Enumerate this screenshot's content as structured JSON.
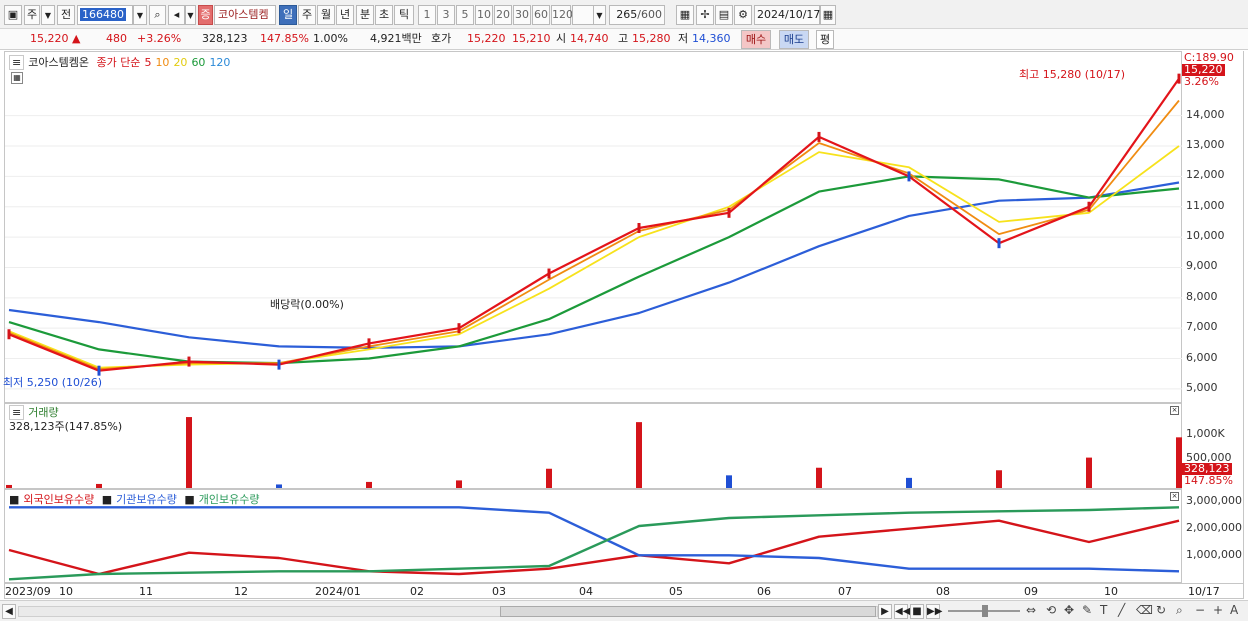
{
  "toolbar": {
    "market_label": "주",
    "all_label": "전",
    "code_value": "166480",
    "search_label": "Q",
    "sound_label": "◀",
    "badge_label": "증",
    "stock_name": "코아스템켐",
    "periods": [
      "일",
      "주",
      "월",
      "년",
      "분",
      "초",
      "틱"
    ],
    "active_period": "일",
    "intervals": [
      "1",
      "3",
      "5",
      "10",
      "20",
      "30",
      "60",
      "120"
    ],
    "count_value": "265",
    "count_total": "/600",
    "date_value": "2024/10/17"
  },
  "quote": {
    "price": "15,220",
    "change": "480",
    "change_pct": "+3.26%",
    "volume": "328,123",
    "volume_pct": "147.85%",
    "turnover_pct": "1.00%",
    "amount": "4,921백만",
    "ask_label": "호가",
    "ask": "15,220",
    "bid": "15,210",
    "open_label": "시",
    "open": "14,740",
    "high_label": "고",
    "high": "15,280",
    "low_label": "저",
    "low": "14,360",
    "buy_label": "매수",
    "sell_label": "매도",
    "eq_label": "평"
  },
  "price_panel": {
    "name": "코아스템켐온",
    "ma_title": "종가 단순",
    "ma_periods": [
      "5",
      "10",
      "20",
      "60",
      "120"
    ],
    "annotation_high": "최고 15,280 (10/17)",
    "annotation_low": "최저 5,250 (10/26)",
    "annotation_dividend": "배당락(0.00%)"
  },
  "price_axis": {
    "top_tag": "C:189.90",
    "price_tag": "15,220",
    "pct_tag": "3.26%",
    "ticks": [
      "14,000",
      "13,000",
      "12,000",
      "11,000",
      "10,000",
      "9,000",
      "8,000",
      "7,000",
      "6,000",
      "5,000"
    ]
  },
  "volume_panel": {
    "name": "거래량",
    "value": "328,123주(147.85%)"
  },
  "volume_axis": {
    "ticks": [
      "1,000K",
      "500,000"
    ],
    "tag_value": "328,123",
    "tag_pct": "147.85%"
  },
  "holdings_panel": {
    "series": [
      "외국인보유수량",
      "기관보유수량",
      "개인보유수량"
    ]
  },
  "holdings_axis": {
    "ticks": [
      "3,000,000",
      "2,000,000",
      "1,000,000"
    ]
  },
  "date_axis": {
    "labels": [
      "2023/09",
      "10",
      "11",
      "12",
      "2024/01",
      "02",
      "03",
      "04",
      "05",
      "06",
      "07",
      "08",
      "09",
      "10"
    ],
    "last": "10/17"
  },
  "colors": {
    "up": "#d4141a",
    "down": "#1f4fd4",
    "ma5": "#e3141a",
    "ma10": "#f08c12",
    "ma20": "#f7e21c",
    "ma60": "#1c9a3a",
    "ma120": "#2c5ed8",
    "foreign": "#d4141a",
    "institution": "#2c5ed8",
    "individual": "#2a9a5a"
  },
  "chart_data": [
    {
      "type": "line",
      "title": "코아스템켐온",
      "ylim": [
        4700,
        15900
      ],
      "x": [
        "2023/09",
        "2023/10",
        "2023/11",
        "2023/12",
        "2024/01",
        "2024/02",
        "2024/03",
        "2024/04",
        "2024/05",
        "2024/06",
        "2024/07",
        "2024/08",
        "2024/09",
        "2024/10"
      ],
      "series": [
        {
          "name": "5",
          "values": [
            6800,
            5600,
            5900,
            5800,
            6500,
            7000,
            8800,
            10300,
            10800,
            13300,
            12000,
            9800,
            11000,
            15220
          ]
        },
        {
          "name": "10",
          "values": [
            6850,
            5650,
            5850,
            5850,
            6400,
            6900,
            8600,
            10200,
            10900,
            13100,
            12100,
            10100,
            10900,
            14500
          ]
        },
        {
          "name": "20",
          "values": [
            6900,
            5700,
            5800,
            5850,
            6300,
            6800,
            8300,
            10000,
            11000,
            12800,
            12300,
            10500,
            10800,
            13000
          ]
        },
        {
          "name": "60",
          "values": [
            7200,
            6300,
            5900,
            5850,
            6000,
            6400,
            7300,
            8700,
            10000,
            11500,
            12000,
            11900,
            11300,
            11600
          ]
        },
        {
          "name": "120",
          "values": [
            7600,
            7200,
            6700,
            6400,
            6350,
            6400,
            6800,
            7500,
            8500,
            9700,
            10700,
            11200,
            11300,
            11800
          ]
        }
      ]
    },
    {
      "type": "bar",
      "title": "거래량",
      "categories": [
        "2023/09",
        "2023/10",
        "2023/11",
        "2023/12",
        "2024/01",
        "2024/02",
        "2024/03",
        "2024/04",
        "2024/05",
        "2024/06",
        "2024/07",
        "2024/08",
        "2024/09",
        "2024/10"
      ],
      "values": [
        60000,
        80000,
        1400000,
        70000,
        120000,
        150000,
        380000,
        1300000,
        250000,
        400000,
        200000,
        350000,
        600000,
        1000000
      ],
      "ylim": [
        0,
        1500000
      ]
    },
    {
      "type": "line",
      "ylim": [
        0,
        3300000
      ],
      "x": [
        "2023/09",
        "2023/10",
        "2023/11",
        "2023/12",
        "2024/01",
        "2024/02",
        "2024/03",
        "2024/04",
        "2024/05",
        "2024/06",
        "2024/07",
        "2024/08",
        "2024/09",
        "2024/10"
      ],
      "series": [
        {
          "name": "외국인보유수량",
          "values": [
            1200000,
            300000,
            1100000,
            900000,
            400000,
            300000,
            500000,
            1000000,
            700000,
            1700000,
            2000000,
            2300000,
            1500000,
            2300000
          ]
        },
        {
          "name": "기관보유수량",
          "values": [
            2800000,
            2800000,
            2800000,
            2800000,
            2800000,
            2800000,
            2600000,
            1000000,
            1000000,
            900000,
            500000,
            500000,
            500000,
            400000
          ]
        },
        {
          "name": "개인보유수량",
          "values": [
            100000,
            300000,
            350000,
            400000,
            400000,
            500000,
            600000,
            2100000,
            2400000,
            2500000,
            2600000,
            2650000,
            2700000,
            2800000
          ]
        }
      ]
    }
  ]
}
